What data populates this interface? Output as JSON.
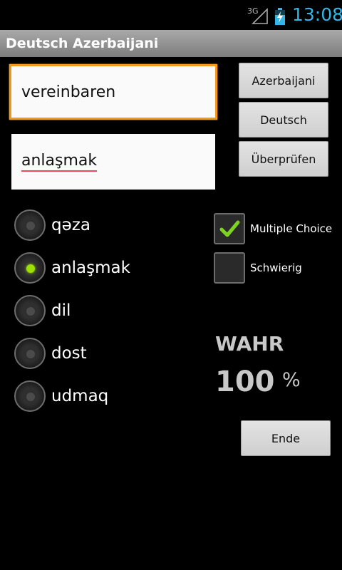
{
  "status": {
    "network_label": "3G",
    "time": "13:08"
  },
  "titlebar": {
    "title": "Deutsch Azerbaijani"
  },
  "fields": {
    "question": "vereinbaren",
    "answer": "anlaşmak"
  },
  "buttons": {
    "azerbaijani": "Azerbaijani",
    "deutsch": "Deutsch",
    "check": "Überprüfen",
    "end": "Ende"
  },
  "choices": [
    {
      "label": "qəza",
      "selected": false
    },
    {
      "label": "anlaşmak",
      "selected": true
    },
    {
      "label": "dil",
      "selected": false
    },
    {
      "label": "dost",
      "selected": false
    },
    {
      "label": "udmaq",
      "selected": false
    }
  ],
  "options": {
    "multiple_choice": {
      "label": "Multiple Choice",
      "checked": true
    },
    "difficult": {
      "label": "Schwierig",
      "checked": false
    }
  },
  "result": {
    "label": "WAHR",
    "score": "100",
    "unit": "%"
  },
  "colors": {
    "accent_focus": "#f39a1b",
    "radio_on": "#9be000",
    "checkmark": "#7ed321",
    "clock": "#33b5e5"
  }
}
